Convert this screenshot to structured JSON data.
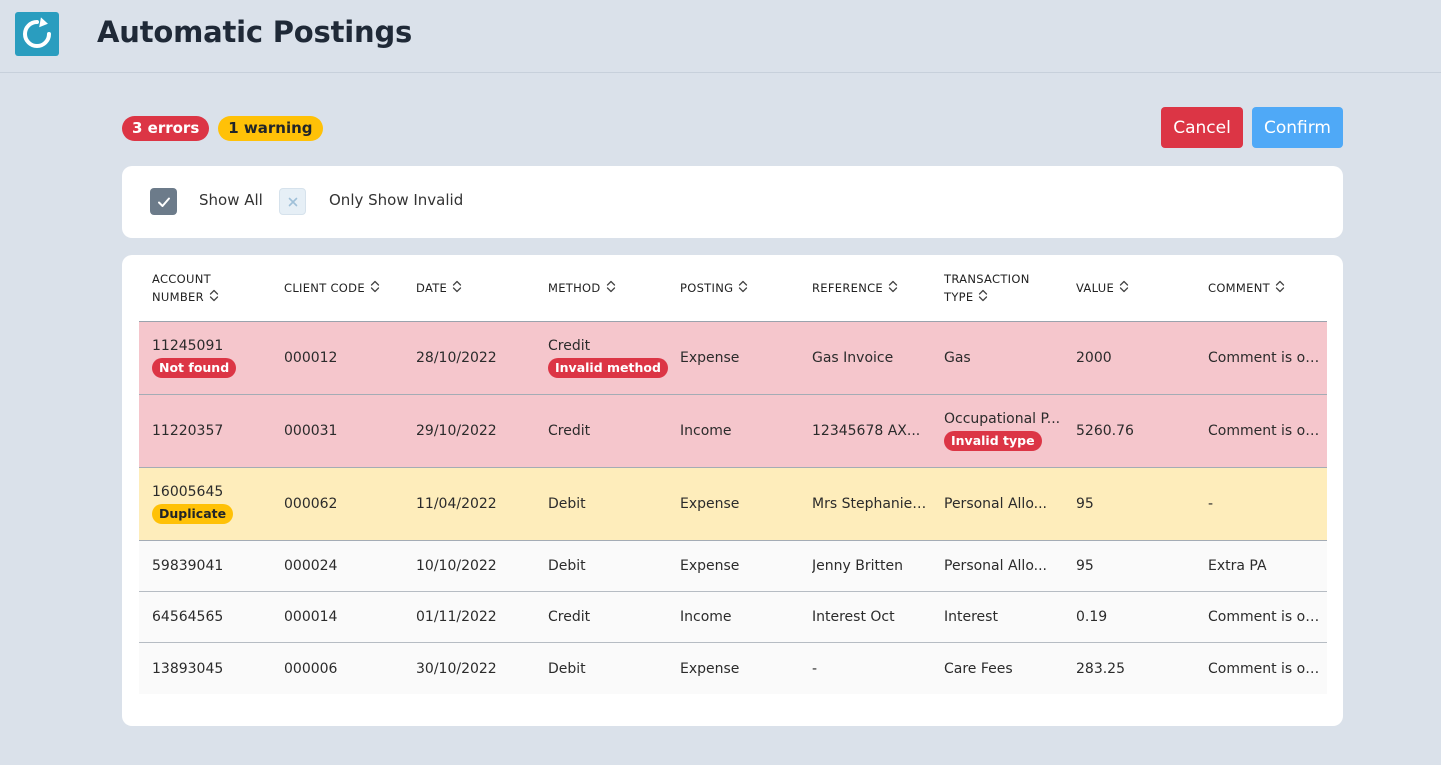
{
  "app": {
    "title": "Automatic Postings"
  },
  "summary": {
    "errors": "3 errors",
    "warnings": "1 warning"
  },
  "actions": {
    "cancel": "Cancel",
    "confirm": "Confirm"
  },
  "filters": {
    "show_all": "Show All",
    "only_invalid": "Only Show Invalid"
  },
  "colors": {
    "error": "#dc3545",
    "warning": "#ffc107",
    "confirm": "#4fa9f7",
    "brand": "#2a9dbf"
  },
  "table": {
    "headers": [
      {
        "line1": "ACCOUNT",
        "line2": "NUMBER"
      },
      {
        "line1": "CLIENT CODE",
        "line2": ""
      },
      {
        "line1": "DATE",
        "line2": ""
      },
      {
        "line1": "METHOD",
        "line2": ""
      },
      {
        "line1": "POSTING",
        "line2": ""
      },
      {
        "line1": "REFERENCE",
        "line2": ""
      },
      {
        "line1": "TRANSACTION",
        "line2": "TYPE"
      },
      {
        "line1": "VALUE",
        "line2": ""
      },
      {
        "line1": "COMMENT",
        "line2": ""
      }
    ],
    "rows": [
      {
        "status": "error",
        "cells": [
          {
            "text": "11245091",
            "tag": "Not found",
            "tag_type": "error"
          },
          {
            "text": "000012"
          },
          {
            "text": "28/10/2022"
          },
          {
            "text": "Credit",
            "tag": "Invalid method",
            "tag_type": "error"
          },
          {
            "text": "Expense"
          },
          {
            "text": "Gas Invoice"
          },
          {
            "text": "Gas"
          },
          {
            "text": "2000"
          },
          {
            "text": "Comment is op..."
          }
        ]
      },
      {
        "status": "error",
        "cells": [
          {
            "text": "11220357"
          },
          {
            "text": "000031"
          },
          {
            "text": "29/10/2022"
          },
          {
            "text": "Credit"
          },
          {
            "text": "Income"
          },
          {
            "text": "12345678 AX..."
          },
          {
            "text": "Occupational P...",
            "tag": "Invalid type",
            "tag_type": "error"
          },
          {
            "text": "5260.76"
          },
          {
            "text": "Comment is op..."
          }
        ]
      },
      {
        "status": "warning",
        "cells": [
          {
            "text": "16005645",
            "tag": "Duplicate",
            "tag_type": "warning"
          },
          {
            "text": "000062"
          },
          {
            "text": "11/04/2022"
          },
          {
            "text": "Debit"
          },
          {
            "text": "Expense"
          },
          {
            "text": "Mrs Stephanie ..."
          },
          {
            "text": "Personal Allo..."
          },
          {
            "text": "95"
          },
          {
            "text": "-"
          }
        ]
      },
      {
        "status": "ok",
        "cells": [
          {
            "text": "59839041"
          },
          {
            "text": "000024"
          },
          {
            "text": "10/10/2022"
          },
          {
            "text": "Debit"
          },
          {
            "text": "Expense"
          },
          {
            "text": "Jenny Britten"
          },
          {
            "text": "Personal Allo..."
          },
          {
            "text": "95"
          },
          {
            "text": "Extra PA"
          }
        ]
      },
      {
        "status": "ok",
        "cells": [
          {
            "text": "64564565"
          },
          {
            "text": "000014"
          },
          {
            "text": "01/11/2022"
          },
          {
            "text": "Credit"
          },
          {
            "text": "Income"
          },
          {
            "text": "Interest Oct"
          },
          {
            "text": "Interest"
          },
          {
            "text": "0.19"
          },
          {
            "text": "Comment is op..."
          }
        ]
      },
      {
        "status": "ok",
        "cells": [
          {
            "text": "13893045"
          },
          {
            "text": "000006"
          },
          {
            "text": "30/10/2022"
          },
          {
            "text": "Debit"
          },
          {
            "text": "Expense"
          },
          {
            "text": "-"
          },
          {
            "text": "Care Fees"
          },
          {
            "text": "283.25"
          },
          {
            "text": "Comment is op..."
          }
        ]
      }
    ]
  }
}
